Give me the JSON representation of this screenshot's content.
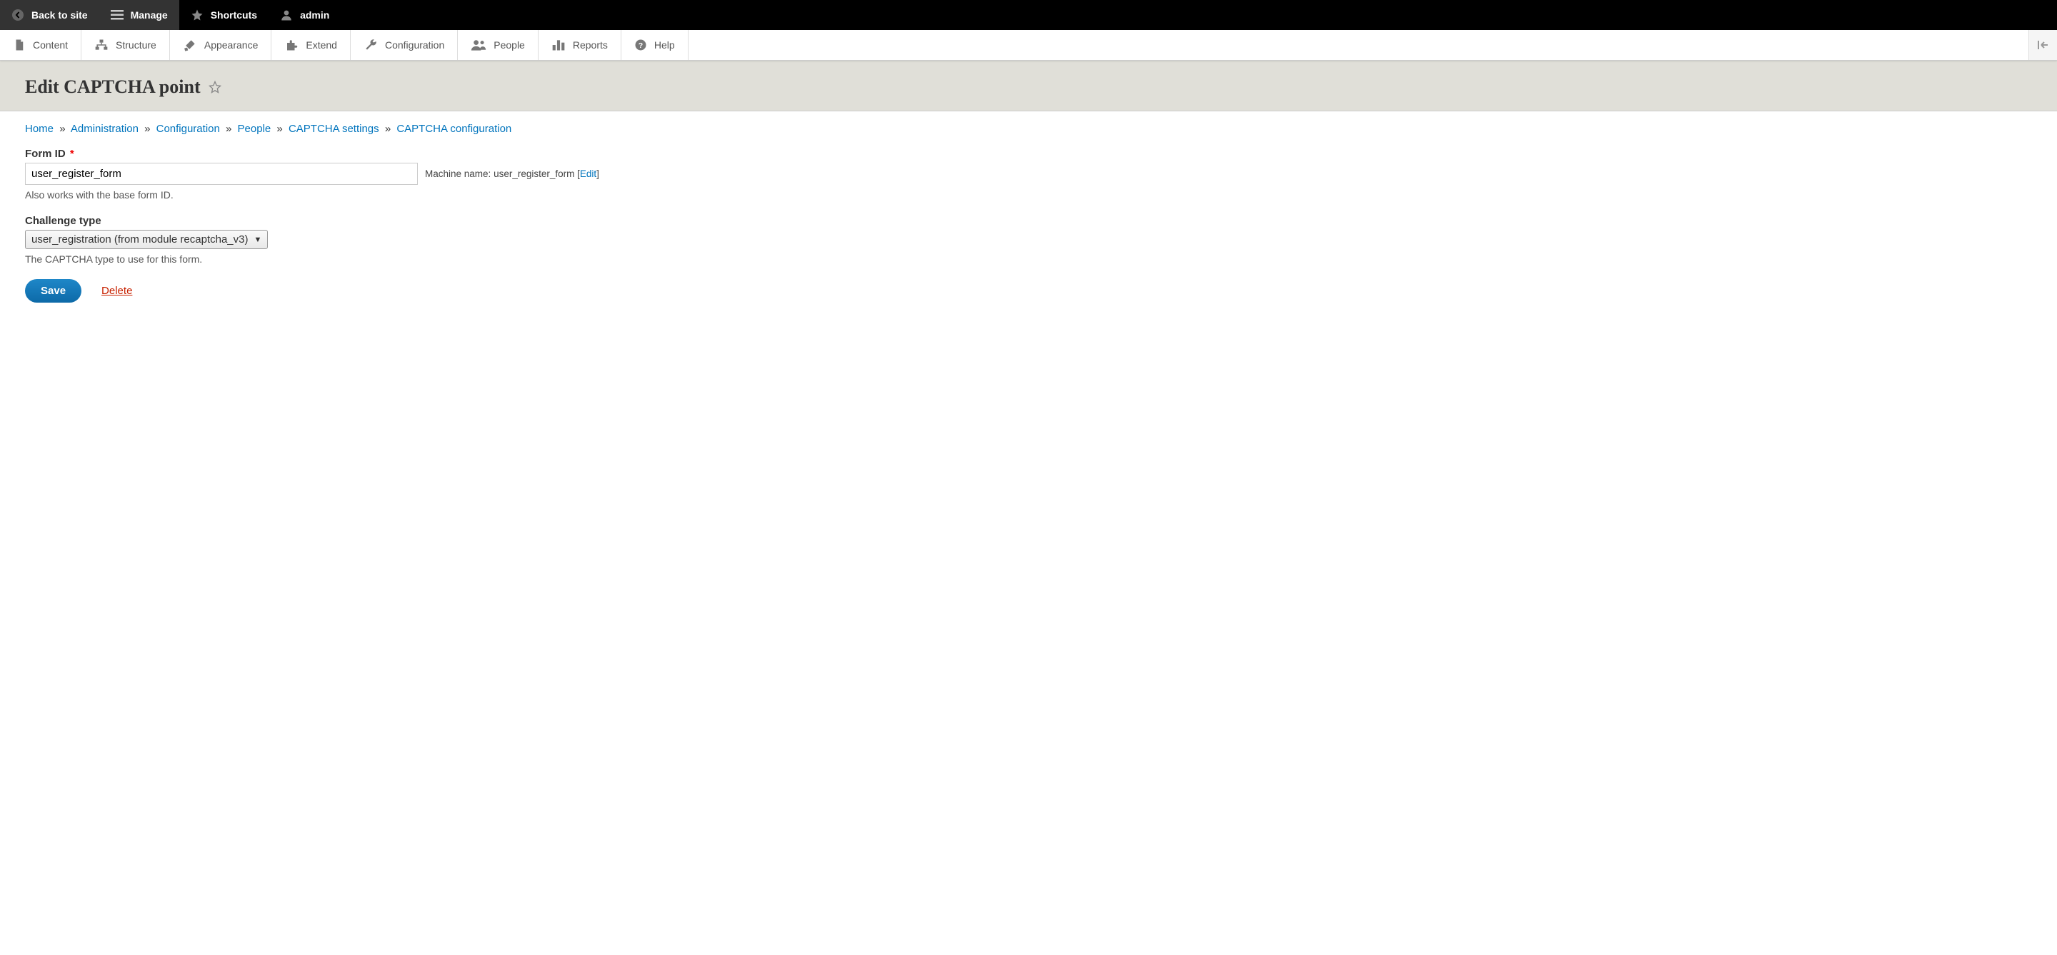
{
  "toolbar": {
    "back": "Back to site",
    "manage": "Manage",
    "shortcuts": "Shortcuts",
    "user": "admin"
  },
  "adminMenu": {
    "content": "Content",
    "structure": "Structure",
    "appearance": "Appearance",
    "extend": "Extend",
    "configuration": "Configuration",
    "people": "People",
    "reports": "Reports",
    "help": "Help"
  },
  "page": {
    "title": "Edit CAPTCHA point"
  },
  "breadcrumb": {
    "home": "Home",
    "administration": "Administration",
    "configuration": "Configuration",
    "people": "People",
    "captchaSettings": "CAPTCHA settings",
    "captchaConfiguration": "CAPTCHA configuration"
  },
  "form": {
    "formId": {
      "label": "Form ID",
      "value": "user_register_form",
      "description": "Also works with the base form ID.",
      "machineLabel": "Machine name:",
      "machineValue": "user_register_form",
      "editLabel": "Edit"
    },
    "challengeType": {
      "label": "Challenge type",
      "value": "user_registration (from module recaptcha_v3)",
      "description": "The CAPTCHA type to use for this form."
    },
    "actions": {
      "save": "Save",
      "delete": "Delete"
    }
  }
}
